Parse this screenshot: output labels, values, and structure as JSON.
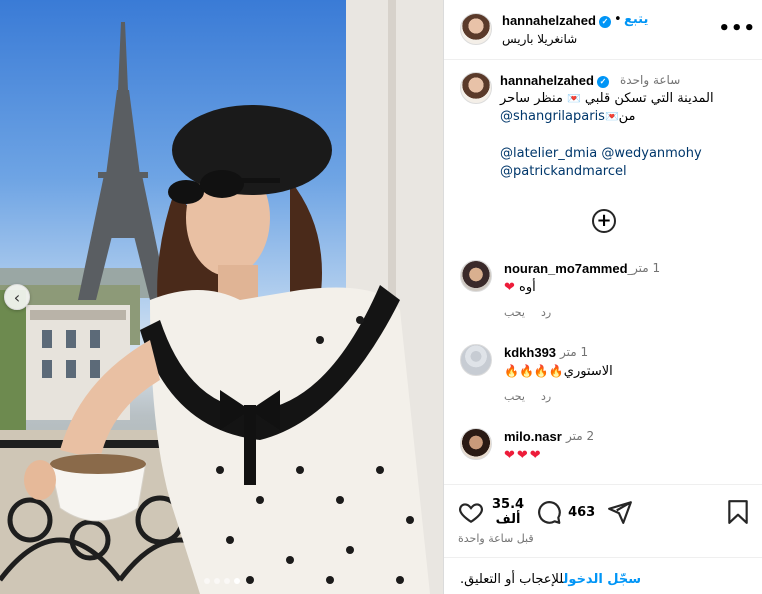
{
  "post": {
    "username": "hannahelzahed",
    "follow_label": "يتبع",
    "location": "شانغريلا باريس",
    "more_label": "•••"
  },
  "caption": {
    "username": "hannahelzahed",
    "time": "ساعة واحدة",
    "text_line1": "المدينة التي تسكن قلبي",
    "text_line1b": "منظر ساحر",
    "text_line2_prefix": "من",
    "text_mention": "@shangrilaparis",
    "tags_line1": "@latelier_dmia @wedyanmohy",
    "tags_line2": "@patrickandmarcel"
  },
  "comments": [
    {
      "user": "nouran_mo7ammed_",
      "time": "1 متر",
      "text": "أوه",
      "like": "يحب",
      "reply": "رد"
    },
    {
      "user": "kdkh393",
      "time": "1 متر",
      "text": "الاستوري",
      "like": "يحب",
      "reply": "رد"
    },
    {
      "user": "milo.nasr",
      "time": "2 متر",
      "text": "",
      "like": "",
      "reply": ""
    }
  ],
  "actions": {
    "likes_count_top": "35.4",
    "likes_count_bottom": "ألف",
    "comments_count": "463",
    "posted_time": "قبل ساعة واحدة"
  },
  "login": {
    "prefix": "للإعجاب أو التعليق.",
    "link": "سجّل الدخول"
  },
  "carousel": {
    "total": 4,
    "active_index": 3
  },
  "icons": {
    "verified": "verified-badge-icon",
    "load_more": "plus-circle-icon",
    "heart": "heart-icon",
    "comment": "comment-icon",
    "share": "share-icon",
    "save": "bookmark-icon"
  },
  "colors": {
    "accent": "#0095f6",
    "link_dark": "#00376b",
    "muted": "#737373",
    "heart": "#ed1c3a"
  }
}
